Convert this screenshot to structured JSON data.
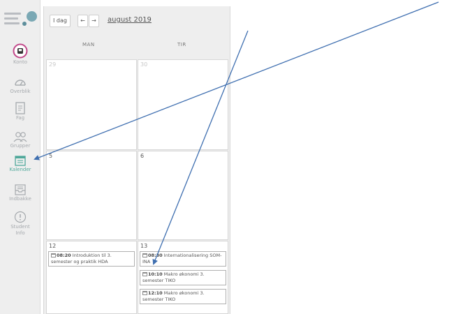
{
  "nav": {
    "items": [
      {
        "label": "Konto",
        "icon": "account-icon"
      },
      {
        "label": "Overblik",
        "icon": "dashboard-icon"
      },
      {
        "label": "Fag",
        "icon": "courses-icon"
      },
      {
        "label": "Grupper",
        "icon": "groups-icon"
      },
      {
        "label": "Kalender",
        "icon": "calendar-icon"
      },
      {
        "label": "Indbakke",
        "icon": "inbox-icon"
      },
      {
        "label": "Student Info",
        "icon": "info-icon"
      }
    ],
    "active_color": "#4fa89a"
  },
  "toolbar": {
    "today_label": "I dag",
    "prev_label": "←",
    "next_label": "→",
    "month_label": "august 2019"
  },
  "calendar": {
    "day_headers": [
      "MAN",
      "TIR"
    ],
    "weeks": [
      {
        "days": [
          "29",
          "30"
        ]
      },
      {
        "days": [
          "5",
          "6"
        ]
      },
      {
        "days": [
          "12",
          "13"
        ]
      }
    ],
    "events": {
      "mon_12": [
        {
          "time": "08:20",
          "title": "Introduktion til 3. semester og praktik HDA"
        }
      ],
      "tue_13": [
        {
          "time": "08:30",
          "title": "Internationalisering SOM-INA"
        },
        {
          "time": "10:10",
          "title": "Makro økonomi 3. semester TIKO"
        },
        {
          "time": "12:10",
          "title": "Makro økonomi 3. semester TIKO"
        }
      ]
    }
  },
  "annotation_color": "#3f6fb0"
}
